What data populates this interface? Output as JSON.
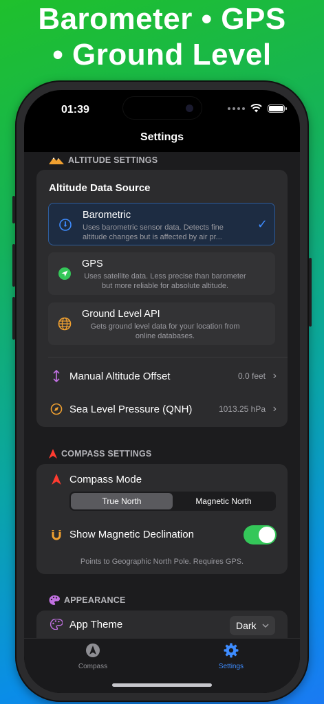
{
  "headline": {
    "line1": "Barometer • GPS",
    "line2": "• Ground Level"
  },
  "status": {
    "time": "01:39"
  },
  "nav": {
    "title": "Settings"
  },
  "altitude": {
    "section_label": "ALTITUDE SETTINGS",
    "card_title": "Altitude Data Source",
    "sources": [
      {
        "title": "Barometric",
        "desc": "Uses barometric sensor data. Detects fine altitude changes but is affected by air pr...",
        "selected": true,
        "icon": "gauge-icon"
      },
      {
        "title": "GPS",
        "desc": "Uses satellite data. Less precise than barometer but more reliable for absolute altitude.",
        "selected": false,
        "icon": "location-arrow-icon"
      },
      {
        "title": "Ground Level API",
        "desc": "Gets ground level data for your location from online databases.",
        "selected": false,
        "icon": "globe-icon"
      }
    ],
    "offset_label": "Manual Altitude Offset",
    "offset_value": "0.0 feet",
    "qnh_label": "Sea Level Pressure (QNH)",
    "qnh_value": "1013.25 hPa"
  },
  "compass": {
    "section_label": "COMPASS SETTINGS",
    "mode_label": "Compass Mode",
    "options": [
      "True North",
      "Magnetic North"
    ],
    "selected_option": "True North",
    "declination_label": "Show Magnetic Declination",
    "declination_on": true,
    "note": "Points to Geographic North Pole. Requires GPS."
  },
  "appearance": {
    "section_label": "APPEARANCE",
    "theme_label": "App Theme",
    "theme_value": "Dark"
  },
  "tabs": [
    {
      "label": "Compass",
      "icon": "compass-icon",
      "active": false
    },
    {
      "label": "Settings",
      "icon": "gear-icon",
      "active": true
    }
  ],
  "colors": {
    "accent": "#3e8cff",
    "toggle_on": "#34c759",
    "altitude_icon": "#f0a030",
    "compass_icon": "#ff3b30",
    "appearance_icon": "#c070e0"
  }
}
